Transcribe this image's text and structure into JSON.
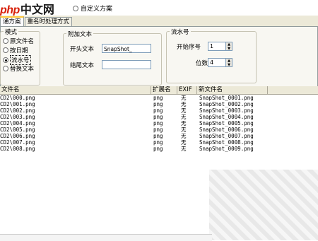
{
  "logo": {
    "php": "php",
    "cn": "中文网"
  },
  "custom_scheme": {
    "label": "自定义方案"
  },
  "tabs": [
    {
      "label": "通方案"
    },
    {
      "label": "重名时处理方式"
    }
  ],
  "mode_group": {
    "title": "模式",
    "options": [
      {
        "label": "原文件名"
      },
      {
        "label": "按日期"
      },
      {
        "label": "流水号"
      },
      {
        "label": "替换文本"
      }
    ],
    "selected_index": 2
  },
  "text_group": {
    "title": "附加文本",
    "prefix_label": "开头文本",
    "prefix_value": "SnapShot_",
    "suffix_label": "结尾文本",
    "suffix_value": ""
  },
  "seq_group": {
    "title": "流水号",
    "start_label": "开始序号",
    "start_value": "1",
    "digits_label": "位数",
    "digits_value": "4"
  },
  "list": {
    "columns": [
      "文件名",
      "扩展名",
      "EXIF",
      "新文件名"
    ],
    "rows": [
      {
        "name": "CD2\\000.png",
        "ext": "png",
        "exif": "无",
        "new": "SnapShot_0001.png"
      },
      {
        "name": "CD2\\001.png",
        "ext": "png",
        "exif": "无",
        "new": "SnapShot_0002.png"
      },
      {
        "name": "CD2\\002.png",
        "ext": "png",
        "exif": "无",
        "new": "SnapShot_0003.png"
      },
      {
        "name": "CD2\\003.png",
        "ext": "png",
        "exif": "无",
        "new": "SnapShot_0004.png"
      },
      {
        "name": "CD2\\004.png",
        "ext": "png",
        "exif": "无",
        "new": "SnapShot_0005.png"
      },
      {
        "name": "CD2\\005.png",
        "ext": "png",
        "exif": "无",
        "new": "SnapShot_0006.png"
      },
      {
        "name": "CD2\\006.png",
        "ext": "png",
        "exif": "无",
        "new": "SnapShot_0007.png"
      },
      {
        "name": "CD2\\007.png",
        "ext": "png",
        "exif": "无",
        "new": "SnapShot_0008.png"
      },
      {
        "name": "CD2\\008.png",
        "ext": "png",
        "exif": "无",
        "new": "SnapShot_0009.png"
      }
    ]
  }
}
